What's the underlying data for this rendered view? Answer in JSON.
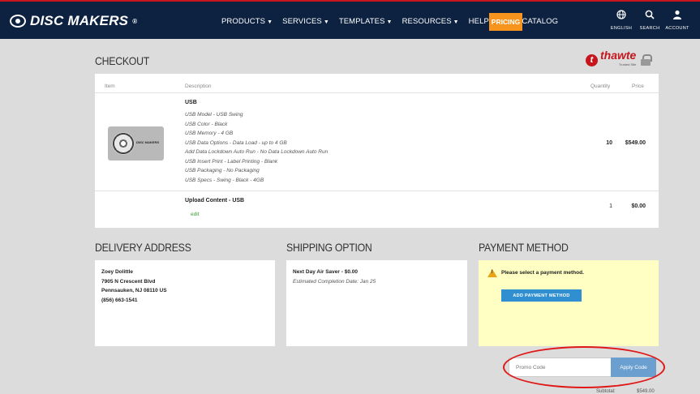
{
  "header": {
    "logo_text": "DISC MAKERS",
    "logo_mark": "®",
    "nav": [
      "PRODUCTS",
      "SERVICES",
      "TEMPLATES",
      "RESOURCES",
      "HELP",
      "FREE CATALOG"
    ],
    "pricing_label": "PRICING",
    "utils": [
      {
        "icon": "globe-icon",
        "label": "ENGLISH"
      },
      {
        "icon": "search-icon",
        "label": "SEARCH"
      },
      {
        "icon": "account-icon",
        "label": "ACCOUNT"
      }
    ]
  },
  "checkout": {
    "title": "CHECKOUT",
    "badge_brand": "thawte",
    "badge_sub": "Trusted Site",
    "columns": {
      "item": "Item",
      "description": "Description",
      "quantity": "Quantity",
      "price": "Price"
    },
    "items": [
      {
        "title": "USB",
        "specs": [
          "USB Model - USB Swing",
          "USB Color - Black",
          "USB Memory - 4 GB",
          "USB Data Options - Data Load - up to 4 GB",
          "Add Data Lockdown Auto Run - No Data Lockdown Auto Run",
          "USB Insert Print - Label Printing - Blank",
          "USB Packaging - No Packaging",
          "USB Specs - Swing - Black - 4GB"
        ],
        "image_brand": "DISC MAKERS",
        "quantity": "10",
        "price": "$549.00"
      },
      {
        "title": "Upload Content - USB",
        "edit_label": "edit",
        "quantity": "1",
        "price": "$0.00"
      }
    ]
  },
  "delivery": {
    "title": "DELIVERY ADDRESS",
    "name": "Zoey Dolittle",
    "street": "7905 N Crescent Blvd",
    "city": "Pennsauken, NJ 08110 US",
    "phone": "(856) 663-1541"
  },
  "shipping": {
    "title": "SHIPPING OPTION",
    "method": "Next Day Air Saver - $0.00",
    "estimate": "Estimated Completion Date: Jan 25"
  },
  "payment": {
    "title": "PAYMENT METHOD",
    "message": "Please select a payment method.",
    "button_label": "ADD PAYMENT METHOD"
  },
  "promo": {
    "placeholder": "Promo Code",
    "apply_label": "Apply Code"
  },
  "subtotal": {
    "label": "Subtotal:",
    "value": "$549.00"
  },
  "colors": {
    "header_bg": "#0d2240",
    "accent_orange": "#f7941d",
    "annotation_red": "#e01818",
    "button_blue": "#2f8fd0"
  }
}
